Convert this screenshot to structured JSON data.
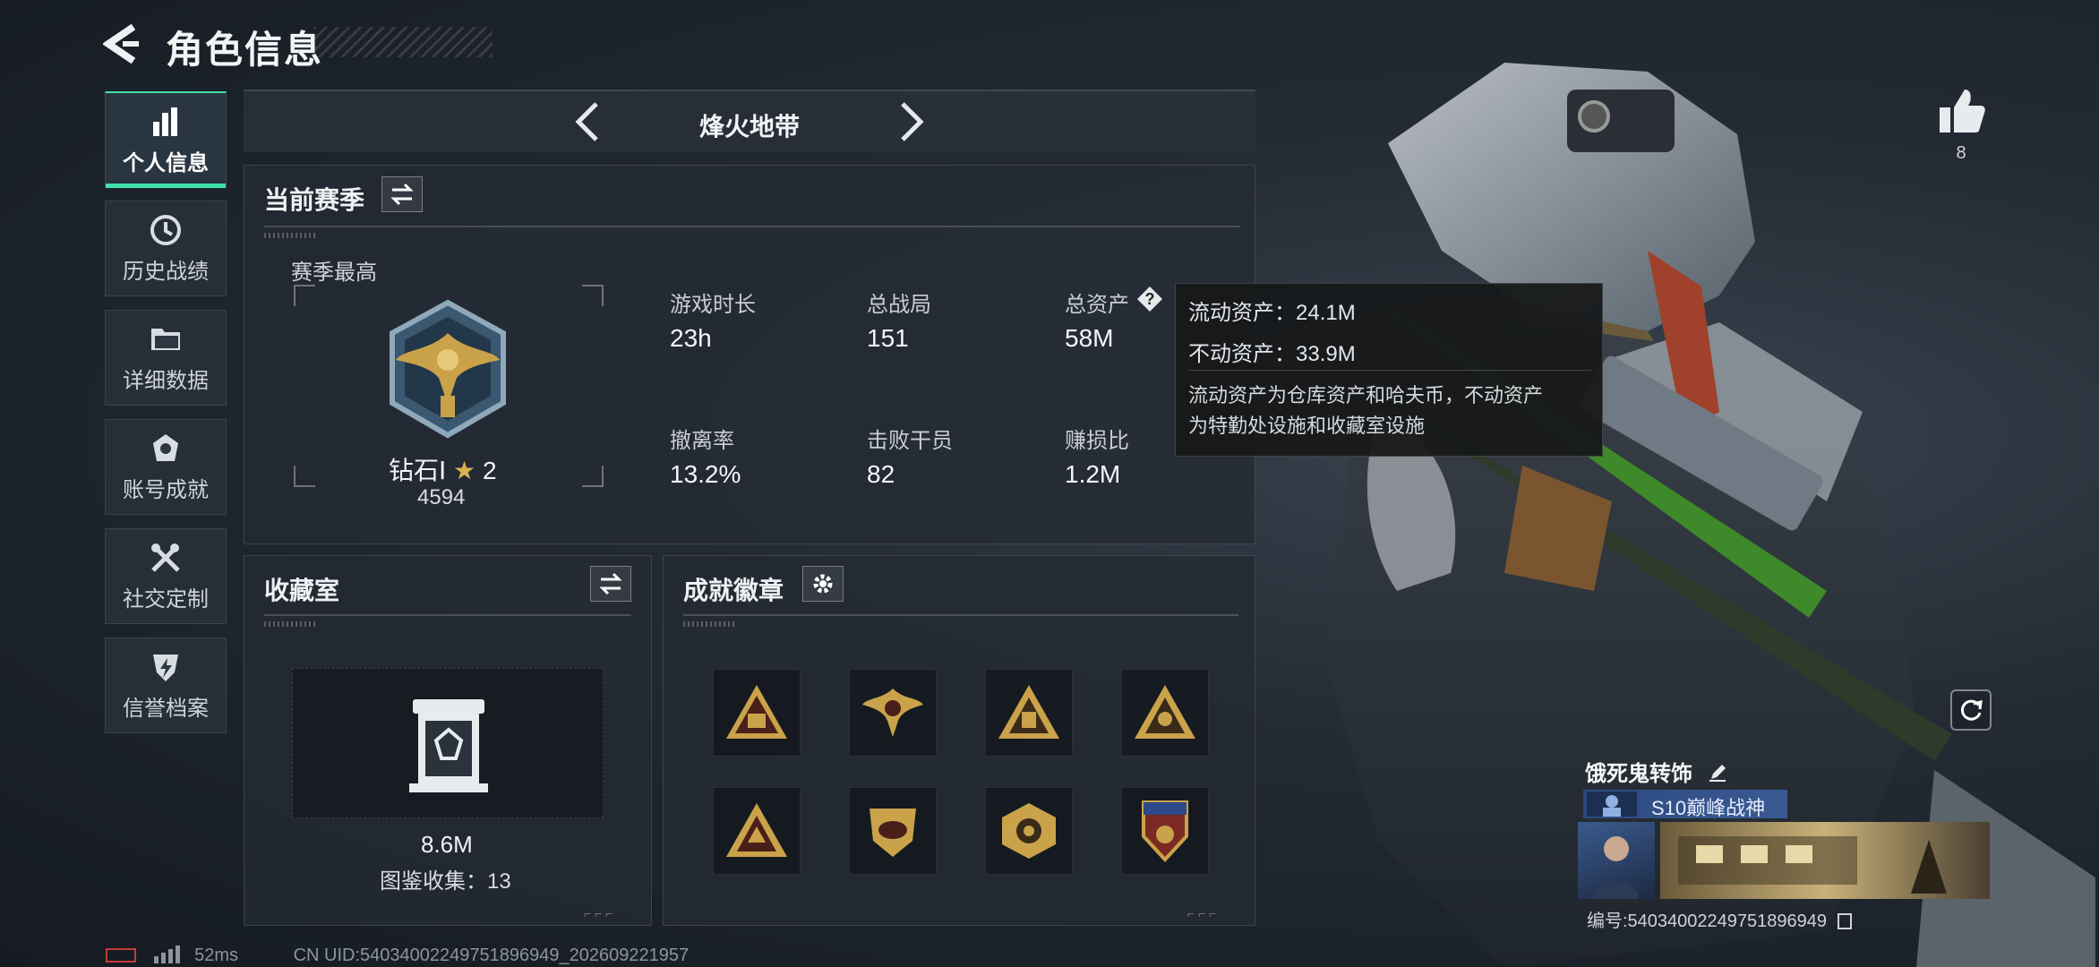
{
  "header": {
    "title": "角色信息"
  },
  "sidebar": {
    "items": [
      {
        "label": "个人信息",
        "icon": "bar-chart-icon",
        "active": true
      },
      {
        "label": "历史战绩",
        "icon": "history-clock-icon",
        "active": false
      },
      {
        "label": "详细数据",
        "icon": "folder-icon",
        "active": false
      },
      {
        "label": "账号成就",
        "icon": "achievement-icon",
        "active": false
      },
      {
        "label": "社交定制",
        "icon": "tools-icon",
        "active": false
      },
      {
        "label": "信誉档案",
        "icon": "shield-lightning-icon",
        "active": false
      }
    ]
  },
  "mode": {
    "title": "烽火地带"
  },
  "season": {
    "heading": "当前赛季",
    "best_label": "赛季最高",
    "rank_name": "钻石Ⅰ",
    "rank_stars": "2",
    "rank_score": "4594",
    "stats": [
      {
        "label": "游戏时长",
        "value": "23h"
      },
      {
        "label": "总战局",
        "value": "151"
      },
      {
        "label": "总资产",
        "value": "58M"
      },
      {
        "label": "撤离率",
        "value": "13.2%"
      },
      {
        "label": "击败干员",
        "value": "82"
      },
      {
        "label": "赚损比",
        "value": "1.2M"
      }
    ]
  },
  "tooltip": {
    "liquid": "流动资产：24.1M",
    "fixed": "不动资产：33.9M",
    "desc_line1": "流动资产为仓库资产和哈夫币，不动资产",
    "desc_line2": "为特勤处设施和收藏室设施"
  },
  "collection": {
    "heading": "收藏室",
    "value": "8.6M",
    "collect_label": "图鉴收集：13"
  },
  "achievements": {
    "heading": "成就徽章"
  },
  "profile": {
    "like_count": "8",
    "nickname": "饿死鬼转饰",
    "title_tag": "S10巅峰战神",
    "serial": "编号:54034002249751896949"
  },
  "footer": {
    "ping": "52ms",
    "uid": "CN UID:54034002249751896949_202609221957"
  },
  "colors": {
    "accent": "#3fe0a8",
    "gold": "#c9a24a",
    "panel": "#242b34"
  }
}
